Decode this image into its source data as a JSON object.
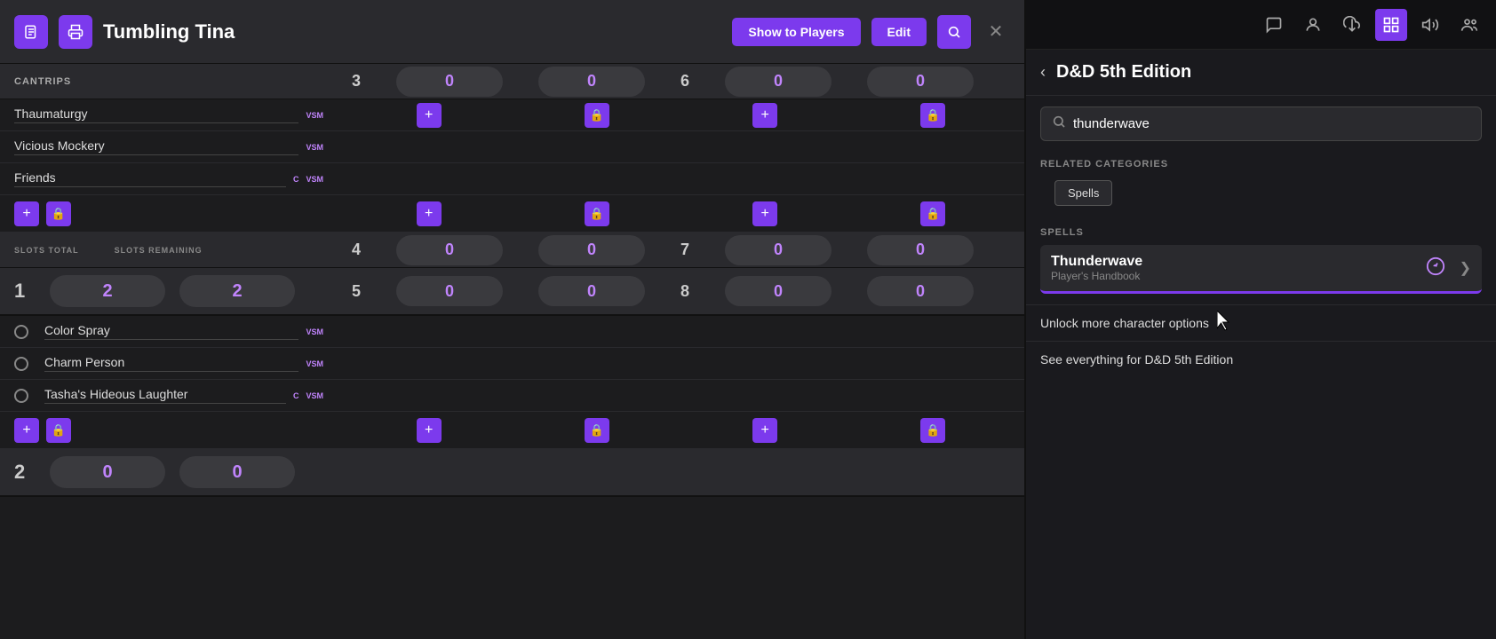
{
  "header": {
    "icon1_label": "📄",
    "icon2_label": "🖨",
    "char_name": "Tumbling Tina",
    "show_to_players": "Show to Players",
    "edit": "Edit",
    "search_icon": "🔍",
    "close": "✕"
  },
  "spells": {
    "cantrip_label": "CANTRIPS",
    "spells_label": "SPELLS",
    "slots_total_label": "SLOTS TOTAL",
    "slots_remaining_label": "SLOTS REMAINING",
    "level_row": [
      {
        "level": "3",
        "val1": "0",
        "val2": "0",
        "val3": "6",
        "val4": "0",
        "val5": "0"
      },
      {
        "level": "4",
        "val1": "0",
        "val2": "0",
        "val3": "7",
        "val4": "0",
        "val5": "0"
      },
      {
        "level": "5",
        "val1": "0",
        "val2": "0",
        "val3": "8",
        "val4": "0",
        "val5": "0"
      }
    ],
    "spell_items_cantrip": [
      {
        "name": "Thaumaturgy",
        "tags": [
          "VSM"
        ]
      },
      {
        "name": "Vicious Mockery",
        "tags": [
          "VSM"
        ]
      },
      {
        "name": "Friends",
        "tags": [
          "C",
          "VSM"
        ]
      }
    ],
    "slot_level1": {
      "level": "1",
      "total": "2",
      "remaining": "2"
    },
    "spell_items_level1": [
      {
        "name": "Color Spray",
        "tags": [
          "VSM"
        ],
        "has_radio": true
      },
      {
        "name": "Charm Person",
        "tags": [
          "VSM"
        ],
        "has_radio": true
      },
      {
        "name": "Tasha's Hideous Laughter",
        "tags": [
          "C",
          "VSM"
        ],
        "has_radio": true
      }
    ],
    "slot_level2": {
      "level": "2",
      "total": "0",
      "remaining": "0"
    }
  },
  "sidebar": {
    "title": "D&D 5th Edition",
    "back_arrow": "‹",
    "search_value": "thunderwave",
    "related_categories_label": "RELATED CATEGORIES",
    "category_spells": "Spells",
    "spells_section_label": "SPELLS",
    "spell_result": {
      "name": "Thunderwave",
      "source": "Player's Handbook",
      "icon": "⚙"
    },
    "footer_links": [
      "Unlock more character options",
      "See everything for D&D 5th Edition"
    ]
  },
  "topbar_icons": [
    {
      "name": "chat-icon",
      "symbol": "💬"
    },
    {
      "name": "character-icon",
      "symbol": "👤"
    },
    {
      "name": "import-icon",
      "symbol": "📥"
    },
    {
      "name": "grid-icon",
      "symbol": "⊞"
    },
    {
      "name": "audio-icon",
      "symbol": "🔊"
    },
    {
      "name": "users-icon",
      "symbol": "👥"
    }
  ],
  "colors": {
    "accent": "#7c3aed",
    "accent_light": "#c084fc",
    "bg_dark": "#1c1c1e",
    "bg_medium": "#2a2a2e",
    "text_primary": "#ffffff",
    "text_secondary": "#aaaaaa"
  }
}
